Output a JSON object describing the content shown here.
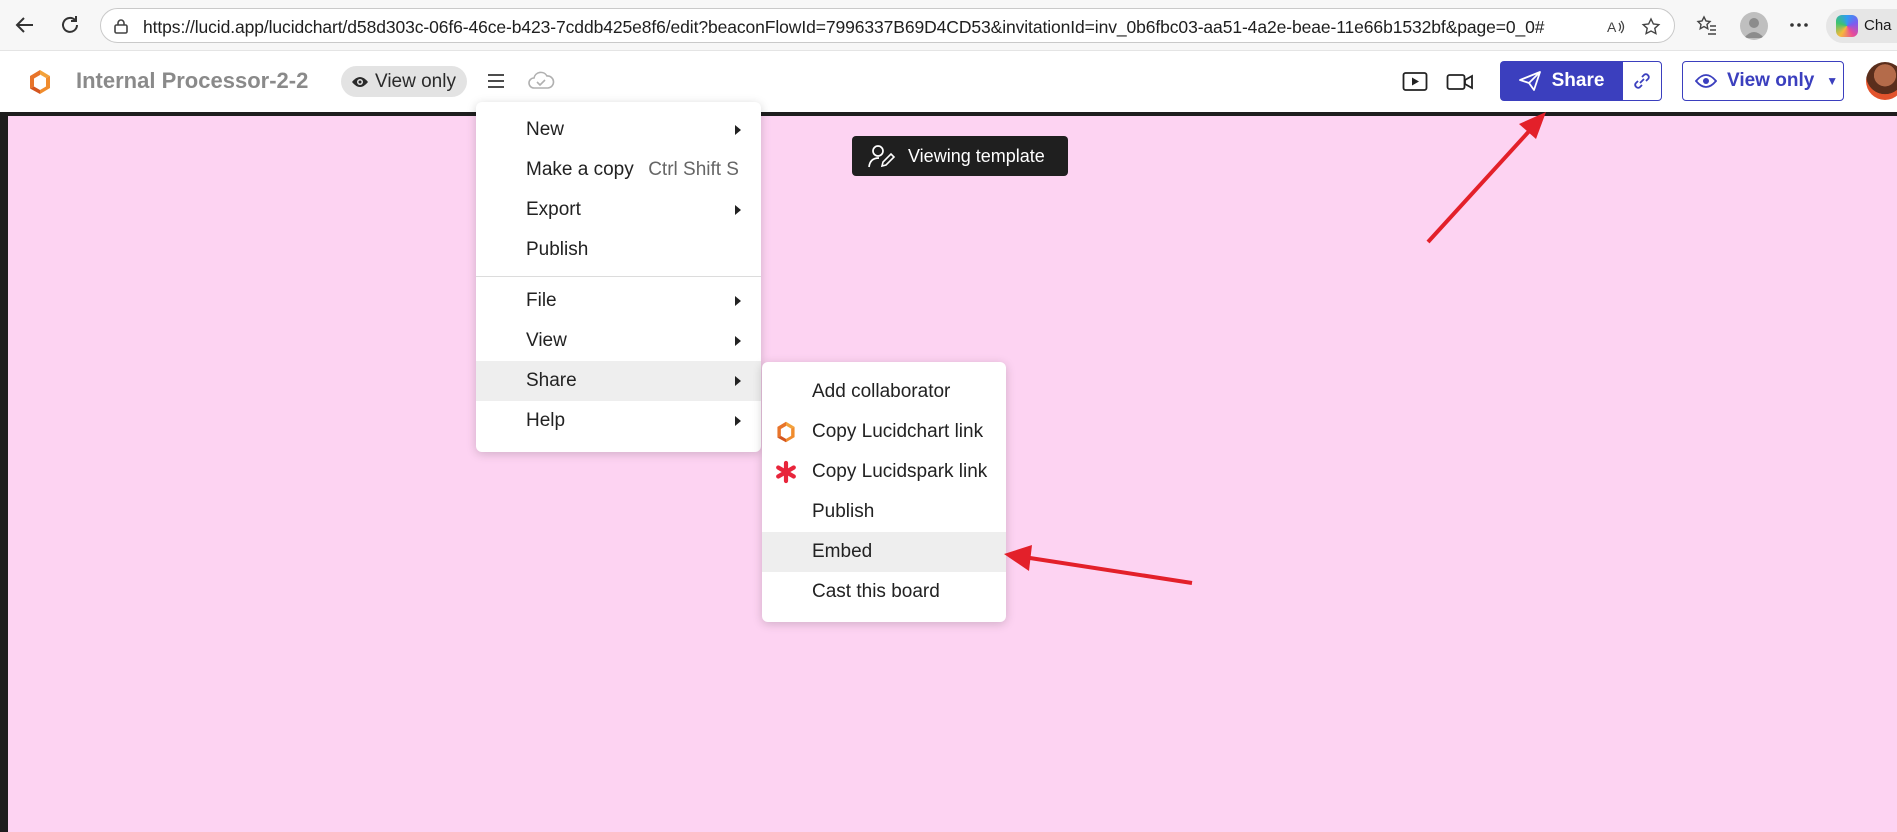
{
  "browser": {
    "url": "https://lucid.app/lucidchart/d58d303c-06f6-46ce-b423-7cddb425e8f6/edit?beaconFlowId=7996337B69D4CD53&invitationId=inv_0b6fbc03-aa51-4a2e-beae-11e66b1532bf&page=0_0#",
    "copilot_label": "Cha"
  },
  "header": {
    "doc_title": "Internal Processor-2-2",
    "view_only_pill": "View only",
    "share_label": "Share",
    "view_only_dropdown": "View only",
    "brand_color": "#3b3fbe"
  },
  "canvas": {
    "background": "#fdd3f2",
    "viewing_badge": "Viewing template"
  },
  "main_menu": {
    "items": [
      {
        "label": "New",
        "shortcut": "",
        "submenu": true
      },
      {
        "label": "Make a copy",
        "shortcut": "Ctrl Shift S",
        "submenu": false
      },
      {
        "label": "Export",
        "shortcut": "",
        "submenu": true
      },
      {
        "label": "Publish",
        "shortcut": "",
        "submenu": false
      },
      {
        "label": "File",
        "shortcut": "",
        "submenu": true
      },
      {
        "label": "View",
        "shortcut": "",
        "submenu": true
      },
      {
        "label": "Share",
        "shortcut": "",
        "submenu": true
      },
      {
        "label": "Help",
        "shortcut": "",
        "submenu": true
      }
    ]
  },
  "share_submenu": {
    "items": [
      {
        "label": "Add collaborator",
        "icon": ""
      },
      {
        "label": "Copy Lucidchart link",
        "icon": "lucidchart-icon"
      },
      {
        "label": "Copy Lucidspark link",
        "icon": "lucidspark-icon"
      },
      {
        "label": "Publish",
        "icon": ""
      },
      {
        "label": "Embed",
        "icon": ""
      },
      {
        "label": "Cast this board",
        "icon": ""
      }
    ]
  },
  "annotation_color": "#e3202a"
}
